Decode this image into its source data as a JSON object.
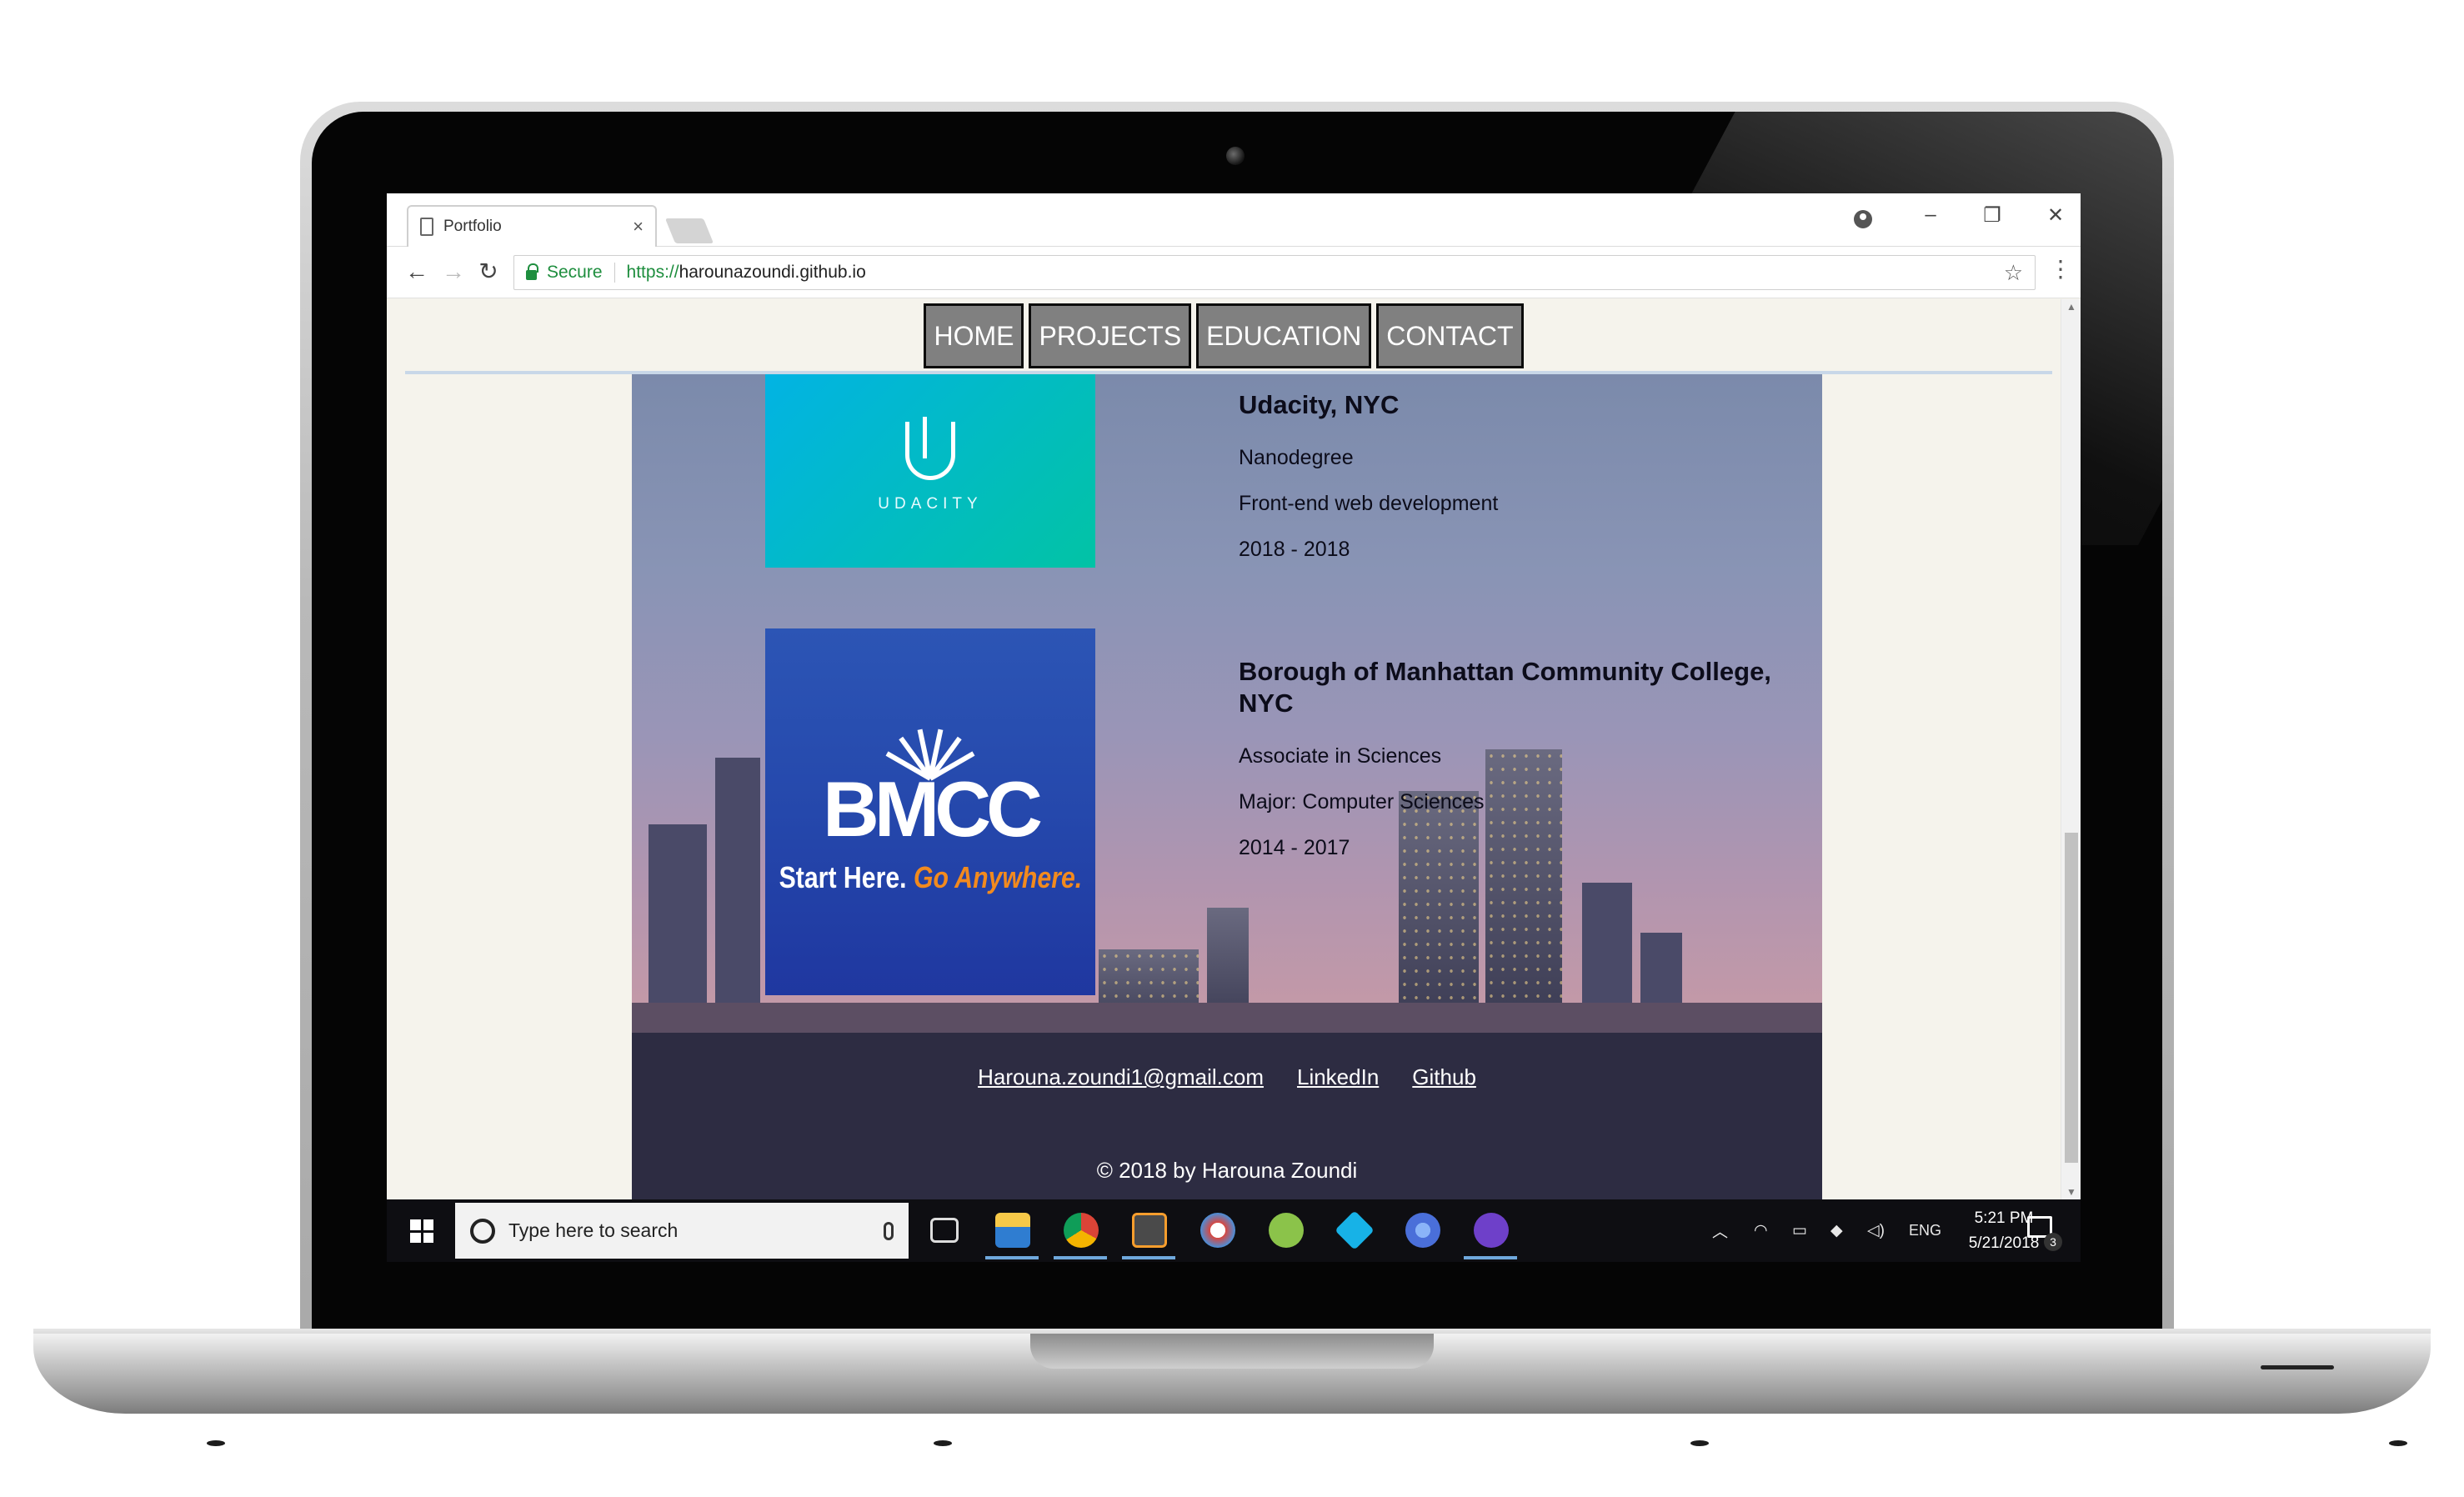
{
  "browser": {
    "tab_title": "Portfolio",
    "tab_close": "×",
    "url_secure_label": "Secure",
    "url_scheme": "https://",
    "url_host": "harounazoundi.github.io",
    "window_controls": {
      "minimize": "–",
      "restore": "❐",
      "close": "✕"
    },
    "nav": {
      "back": "←",
      "forward": "→",
      "reload": "↻"
    },
    "bookmark": "☆",
    "menu": "⋮"
  },
  "site_nav": {
    "items": [
      {
        "label": "HOME"
      },
      {
        "label": "PROJECTS"
      },
      {
        "label": "EDUCATION"
      },
      {
        "label": "CONTACT"
      }
    ]
  },
  "education": [
    {
      "school": "Udacity, NYC",
      "degree": "Nanodegree",
      "field": "Front-end web development",
      "years": "2018 - 2018",
      "logo": {
        "word": "UDACITY",
        "icon": "udacity-u-icon"
      }
    },
    {
      "school": "Borough of Manhattan Community College, NYC",
      "degree": "Associate in Sciences",
      "field": "Major: Computer Sciences",
      "years": "2014 - 2017",
      "logo": {
        "word": "BMCC",
        "tagline_a": "Start Here.",
        "tagline_b": "Go Anywhere."
      }
    }
  ],
  "footer": {
    "links": [
      {
        "label": "Harouna.zoundi1@gmail.com"
      },
      {
        "label": "LinkedIn"
      },
      {
        "label": "Github"
      }
    ],
    "copyright": "© 2018 by Harouna Zoundi"
  },
  "taskbar": {
    "search_placeholder": "Type here to search",
    "tray_language": "ENG",
    "time": "5:21 PM",
    "date": "5/21/2018",
    "notification_count": "3",
    "pinned_apps": [
      "file-explorer-icon",
      "chrome-icon",
      "sublime-text-icon",
      "paint-icon",
      "android-studio-icon",
      "kodi-icon",
      "chromium-icon",
      "github-desktop-icon"
    ]
  },
  "colors": {
    "nav_bg": "#808080",
    "footer_bg": "#2d2c42",
    "udacity": "#02b3e4",
    "bmcc": "#2548ac",
    "secure_green": "#1e8e3e"
  }
}
